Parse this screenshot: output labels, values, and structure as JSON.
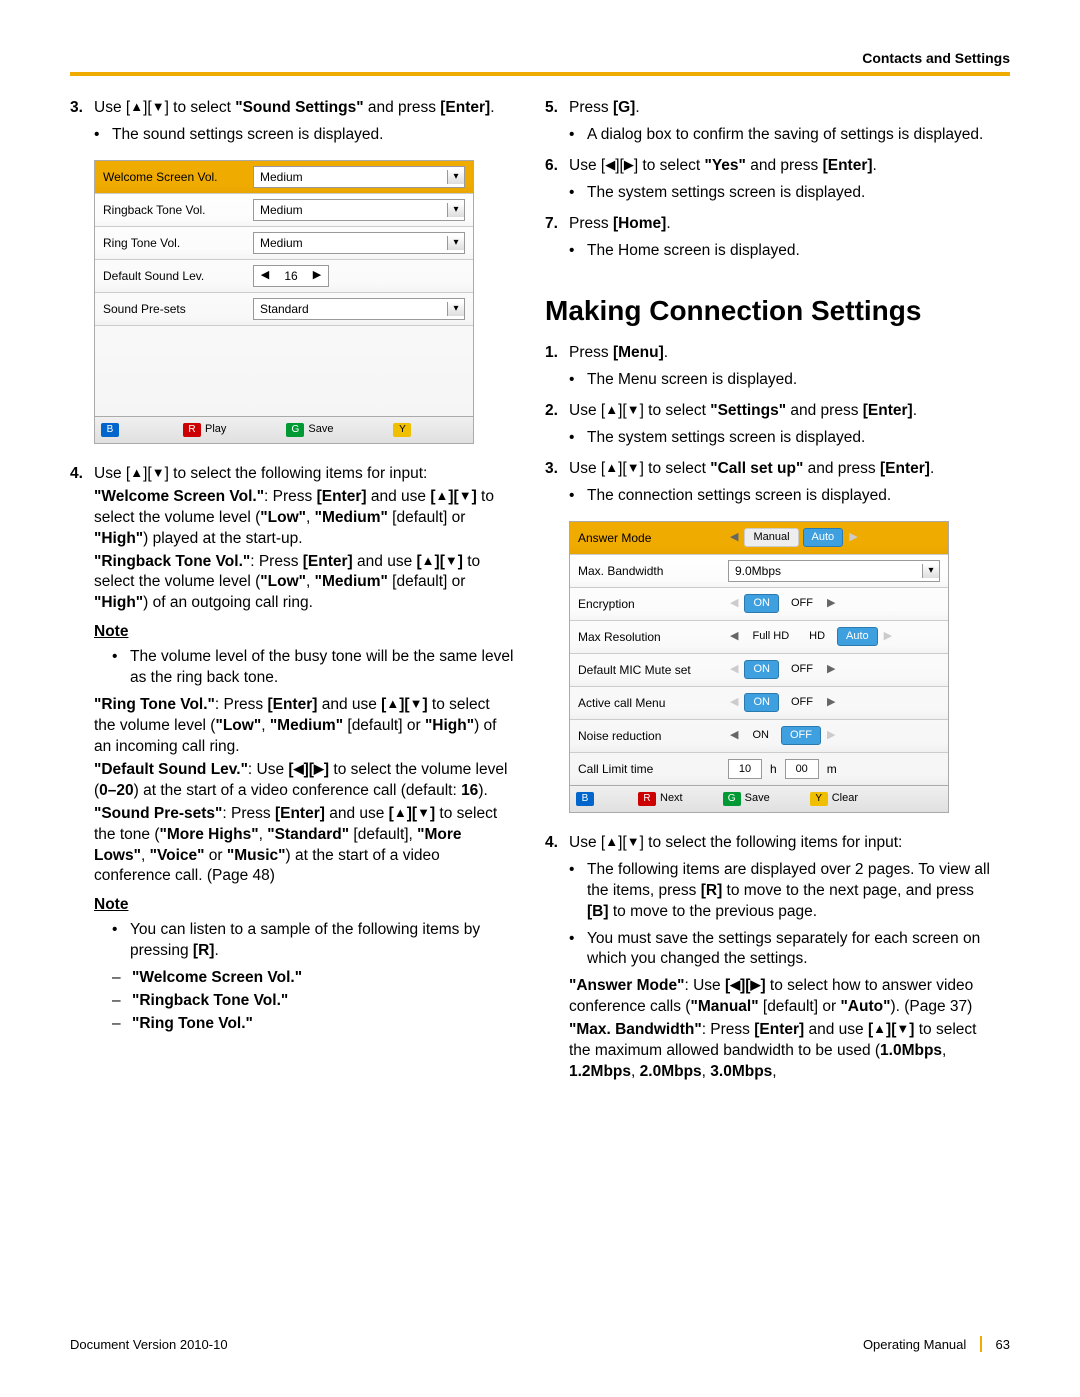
{
  "header": {
    "section_title": "Contacts and Settings"
  },
  "glyphs": {
    "up": "▲",
    "down": "▼",
    "left": "◀",
    "right": "▶"
  },
  "left": {
    "step3": {
      "num": "3.",
      "text_pre": "Use [",
      "text_mid1": "][",
      "text_mid2": "] to select ",
      "sound_settings": "\"Sound Settings\"",
      "text_end": " and press ",
      "enter": "[Enter]",
      "period": ".",
      "bullet": "The sound settings screen is displayed."
    },
    "shot1": {
      "rows": [
        {
          "label": "Welcome Screen Vol.",
          "type": "dropdown",
          "value": "Medium",
          "hdr": true
        },
        {
          "label": "Ringback Tone Vol.",
          "type": "dropdown",
          "value": "Medium"
        },
        {
          "label": "Ring Tone Vol.",
          "type": "dropdown",
          "value": "Medium"
        },
        {
          "label": "Default Sound Lev.",
          "type": "spinner",
          "value": "16"
        },
        {
          "label": "Sound Pre-sets",
          "type": "dropdown",
          "value": "Standard"
        }
      ],
      "footer": {
        "r": "Play",
        "g": "Save"
      }
    },
    "step4": {
      "num": "4.",
      "intro_a": "Use [",
      "intro_b": "][",
      "intro_c": "] to select the following items for input:",
      "p1": "\"Welcome Screen Vol.\": Press [Enter] and use [▲][▼] to select the volume level (\"Low\", \"Medium\" [default] or \"High\") played at the start-up.",
      "p2": "\"Ringback Tone Vol.\": Press [Enter] and use [▲][▼] to select the volume level (\"Low\", \"Medium\" [default] or \"High\") of an outgoing call ring.",
      "note1": "Note",
      "note1_bullet": "The volume level of the busy tone will be the same level as the ring back tone.",
      "p3": "\"Ring Tone Vol.\": Press [Enter] and use [▲][▼] to select the volume level (\"Low\", \"Medium\" [default] or \"High\") of an incoming call ring.",
      "p4": "\"Default Sound Lev.\": Use [◀][▶] to select the volume level (0–20) at the start of a video conference call (default: 16).",
      "p5": "\"Sound Pre-sets\": Press [Enter] and use [▲][▼] to select the tone (\"More Highs\", \"Standard\" [default], \"More Lows\", \"Voice\" or \"Music\") at the start of a video conference call. (Page 48)",
      "note2": "Note",
      "note2_bullet": "You can listen to a sample of the following items by pressing [R].",
      "dash1": "\"Welcome Screen Vol.\"",
      "dash2": "\"Ringback Tone Vol.\"",
      "dash3": "\"Ring Tone Vol.\""
    }
  },
  "right": {
    "step5": {
      "num": "5.",
      "text": "Press ",
      "g": "[G]",
      "period": ".",
      "bullet": "A dialog box to confirm the saving of settings is displayed."
    },
    "step6": {
      "num": "6.",
      "a": "Use [",
      "b": "][",
      "c": "] to select ",
      "yes": "\"Yes\"",
      "d": " and press ",
      "enter": "[Enter]",
      "period": ".",
      "bullet": "The system settings screen is displayed."
    },
    "step7": {
      "num": "7.",
      "text": "Press ",
      "home": "[Home]",
      "period": ".",
      "bullet": "The Home screen is displayed."
    },
    "section_title": "Making Connection Settings",
    "c1": {
      "num": "1.",
      "text": "Press ",
      "menu": "[Menu]",
      "period": ".",
      "bullet": "The Menu screen is displayed."
    },
    "c2": {
      "num": "2.",
      "a": "Use [",
      "b": "][",
      "c": "] to select ",
      "settings": "\"Settings\"",
      "d": " and press ",
      "enter": "[Enter]",
      "period": ".",
      "bullet": "The system settings screen is displayed."
    },
    "c3": {
      "num": "3.",
      "a": "Use [",
      "b": "][",
      "c": "] to select ",
      "call": "\"Call set up\"",
      "d": " and press ",
      "enter": "[Enter]",
      "period": ".",
      "bullet": "The connection settings screen is displayed."
    },
    "shot2": {
      "rows": [
        {
          "label": "Answer Mode",
          "type": "seg2",
          "opts": [
            "Manual",
            "Auto"
          ],
          "sel": 1,
          "hdr": true
        },
        {
          "label": "Max. Bandwidth",
          "type": "dropdown",
          "value": "9.0Mbps"
        },
        {
          "label": "Encryption",
          "type": "onoff",
          "on": true
        },
        {
          "label": "Max Resolution",
          "type": "seg3",
          "opts": [
            "Full HD",
            "HD",
            "Auto"
          ],
          "sel": 2
        },
        {
          "label": "Default MIC Mute set",
          "type": "onoff",
          "on": true
        },
        {
          "label": "Active call Menu",
          "type": "onoff",
          "on": true
        },
        {
          "label": "Noise reduction",
          "type": "onoff",
          "on": false
        },
        {
          "label": "Call Limit time",
          "type": "time",
          "h": "10",
          "m": "00"
        }
      ],
      "footer": {
        "r": "Next",
        "g": "Save",
        "y": "Clear"
      }
    },
    "c4": {
      "num": "4.",
      "a": "Use [",
      "b": "][",
      "c": "] to select the following items for input:",
      "b1": "The following items are displayed over 2 pages. To view all the items, press [R] to move to the next page, and press [B] to move to the previous page.",
      "b2": "You must save the settings separately for each screen on which you changed the settings.",
      "p1": "\"Answer Mode\": Use [◀][▶] to select how to answer video conference calls (\"Manual\" [default] or \"Auto\"). (Page 37)",
      "p2": "\"Max. Bandwidth\": Press [Enter] and use [▲][▼] to select the maximum allowed bandwidth to be used (1.0Mbps, 1.2Mbps, 2.0Mbps, 3.0Mbps,"
    }
  },
  "footer": {
    "left": "Document Version  2010-10",
    "right_a": "Operating Manual",
    "page": "63"
  }
}
